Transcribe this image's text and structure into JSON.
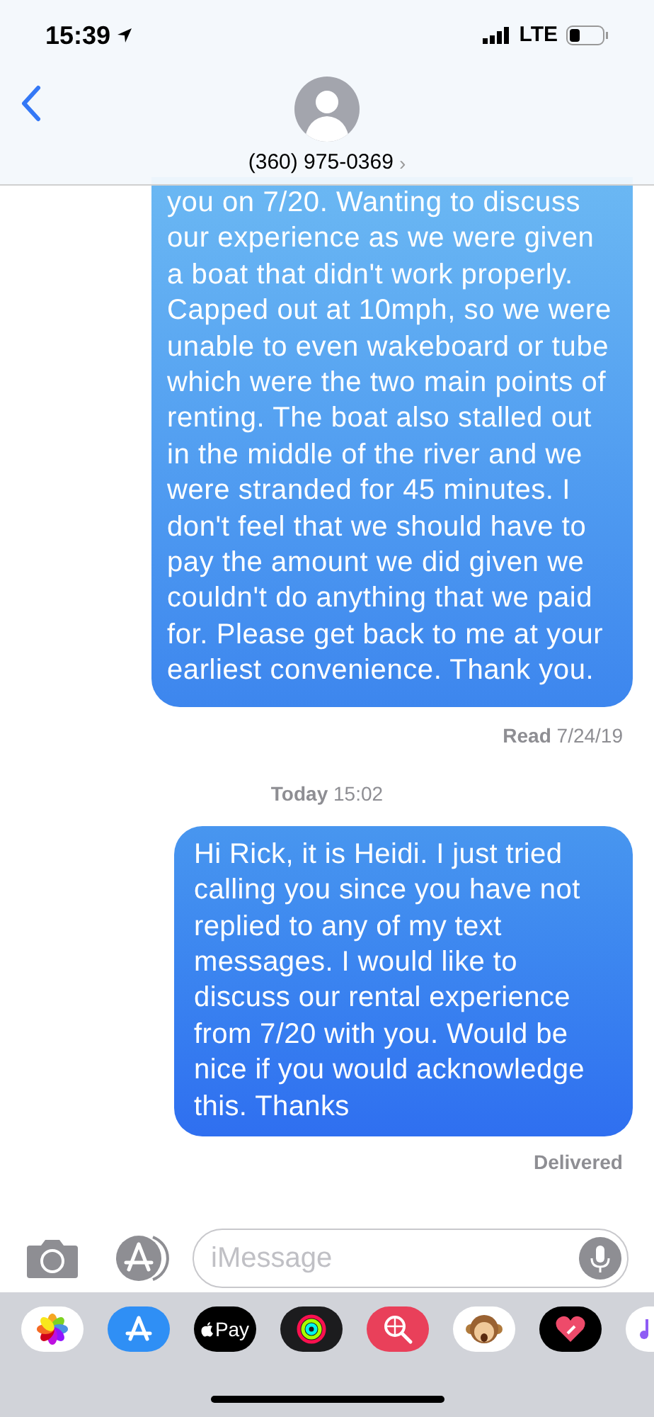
{
  "status_bar": {
    "time": "15:39",
    "network": "LTE"
  },
  "contact": {
    "phone": "(360) 975-0369",
    "chevron": "›"
  },
  "messages": [
    {
      "kind": "sent",
      "text": "you on 7/20. Wanting to discuss our experience as we were given a boat that didn't work properly. Capped out at 10mph, so we were unable to even wakeboard or tube which were the two main points of renting. The boat also stalled out in the middle of the river and we were stranded for 45 minutes. I don't feel that we should have to pay the amount we did given we couldn't do anything that we paid for. Please get back to me at your earliest convenience. Thank you."
    },
    {
      "kind": "receipt",
      "label": "Read",
      "value": "7/24/19"
    },
    {
      "kind": "timestamp",
      "label": "Today",
      "value": "15:02"
    },
    {
      "kind": "sent",
      "text": "Hi Rick, it is Heidi. I just tried calling you since you have not replied to any of my text messages. I would like to discuss our rental experience from 7/20 with you. Would be nice if you would acknowledge this. Thanks"
    },
    {
      "kind": "receipt",
      "label": "Delivered"
    }
  ],
  "composer": {
    "placeholder": "iMessage"
  },
  "app_drawer": {
    "apple_pay_label": "Pay"
  }
}
